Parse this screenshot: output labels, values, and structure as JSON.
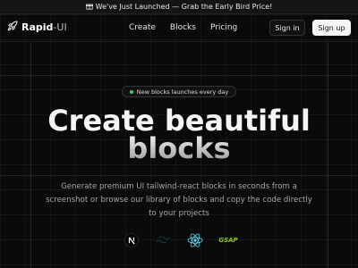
{
  "announcement": {
    "icon": "gift-icon",
    "text": "We've Just Launched — Grab the Early Bird Price!"
  },
  "logo": {
    "icon": "rocket-icon",
    "name": "Rapid",
    "suffix": "-UI"
  },
  "nav": {
    "links": [
      "Create",
      "Blocks",
      "Pricing"
    ]
  },
  "auth": {
    "signin_label": "Sign in",
    "signup_label": "Sign up"
  },
  "badge": {
    "text": "New blocks launches every day",
    "dot_color": "#3ecf5c"
  },
  "hero": {
    "title_line1": "Create beautiful",
    "title_line2": "blocks",
    "subtitle": "Generate premium UI tailwind-react blocks in seconds from a screenshot or browse our library of blocks and copy the code directly to your projects"
  },
  "tech_logos": [
    {
      "icon": "nextjs-icon"
    },
    {
      "icon": "tailwind-icon",
      "color": "#38bdf8"
    },
    {
      "icon": "react-icon",
      "color": "#61dafb"
    },
    {
      "icon": "gsap-icon",
      "text": "GSAP",
      "color": "#88ce02"
    }
  ],
  "colors": {
    "background": "#0a0a0a",
    "accent": "#f5f5f5"
  }
}
